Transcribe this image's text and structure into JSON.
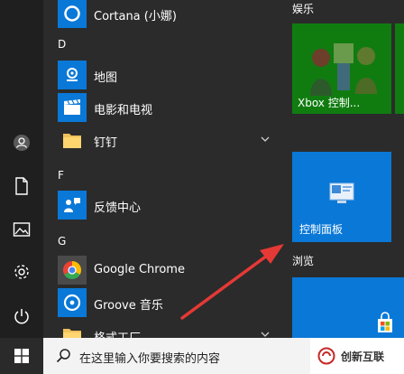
{
  "colors": {
    "accent": "#0a78d7",
    "tile_green": "#107c10",
    "panel_bg": "#2b2b2b",
    "rail_bg": "#1f1f1f",
    "arrow": "#e53935"
  },
  "rail": {
    "icons": [
      "user-icon",
      "document-icon",
      "pictures-icon",
      "settings-icon",
      "power-icon"
    ]
  },
  "app_list": {
    "letters": {
      "d": "D",
      "f": "F",
      "g": "G"
    },
    "items": [
      {
        "label": "Cortana (小娜)",
        "icon": "cortana-icon"
      },
      {
        "label": "地图",
        "icon": "maps-icon"
      },
      {
        "label": "电影和电视",
        "icon": "movies-icon"
      },
      {
        "label": "钉钉",
        "icon": "folder-icon"
      },
      {
        "label": "反馈中心",
        "icon": "feedback-icon"
      },
      {
        "label": "Google Chrome",
        "icon": "chrome-icon"
      },
      {
        "label": "Groove 音乐",
        "icon": "groove-icon"
      },
      {
        "label": "格式工厂",
        "icon": "folder-icon"
      }
    ]
  },
  "tiles": {
    "group_entertainment": "娱乐",
    "xbox_label": "Xbox 控制...",
    "control_panel_label": "控制面板",
    "group_browse": "浏览"
  },
  "taskbar": {
    "search_placeholder": "在这里输入你要搜索的内容"
  },
  "watermark": {
    "text": "创新互联"
  }
}
